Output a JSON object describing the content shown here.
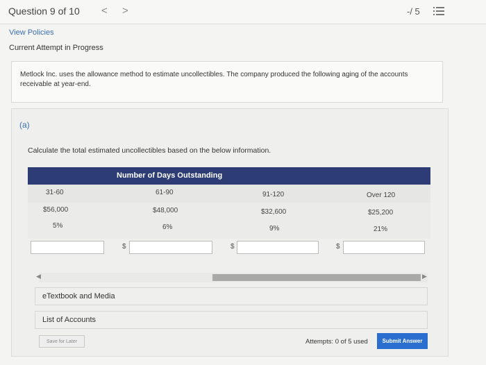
{
  "header": {
    "question_counter": "Question 9 of 10",
    "prev_glyph": "<",
    "next_glyph": ">",
    "score": "-/ 5"
  },
  "links": {
    "view_policies": "View Policies",
    "attempt_status": "Current Attempt in Progress"
  },
  "problem": {
    "text": "Metlock Inc. uses the allowance method to estimate uncollectibles. The company produced the following aging of the accounts receivable at year-end."
  },
  "part": {
    "label": "(a)",
    "instruction": "Calculate the total estimated uncollectibles based on the below information."
  },
  "table": {
    "header": "Number of Days Outstanding",
    "columns": [
      {
        "label": "31-60",
        "balance": "$56,000",
        "rate": "5%"
      },
      {
        "label": "61-90",
        "balance": "$48,000",
        "rate": "6%"
      },
      {
        "label": "91-120",
        "balance": "$32,600",
        "rate": "9%"
      },
      {
        "label": "Over 120",
        "balance": "$25,200",
        "rate": "21%"
      }
    ],
    "currency_symbol": "$"
  },
  "inputs": {
    "col1": "",
    "col2": "",
    "col3": "",
    "col4": ""
  },
  "resources": {
    "etextbook": "eTextbook and Media",
    "accounts": "List of Accounts"
  },
  "footer": {
    "save_later": "Save for Later",
    "attempts": "Attempts: 0 of 5 used",
    "submit": "Submit Answer"
  },
  "colors": {
    "table_header": "#2d3c75",
    "link": "#3a6fb0",
    "submit": "#2a6fcf"
  },
  "icons": {
    "menu": "list-icon",
    "prev": "chevron-left-icon",
    "next": "chevron-right-icon"
  }
}
